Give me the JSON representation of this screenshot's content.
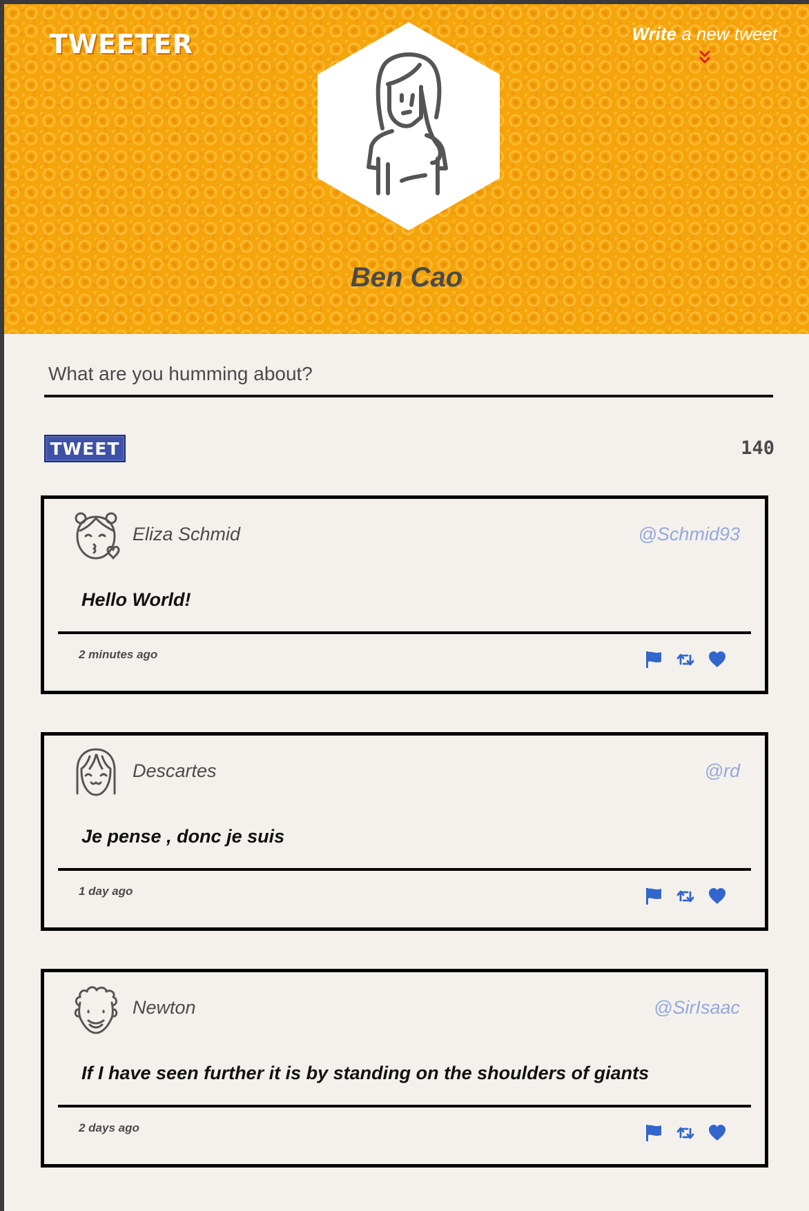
{
  "header": {
    "logo_text": "TWEETER",
    "compose_link_bold": "Write",
    "compose_link_rest": " a new tweet",
    "profile_name": "Ben Cao",
    "avatar_icon": "woman-avatar-icon",
    "compose_arrow_icon": "double-chevron-down-icon"
  },
  "composer": {
    "placeholder": "What are you humming about?",
    "value": "",
    "submit_label": "TWEET",
    "char_counter": "140"
  },
  "tweets": [
    {
      "name": "Eliza Schmid",
      "handle": "@Schmid93",
      "avatar_icon": "girl-kiss-avatar-icon",
      "body": "Hello World!",
      "time": "2 minutes ago"
    },
    {
      "name": "Descartes",
      "handle": "@rd",
      "avatar_icon": "girl-bangs-avatar-icon",
      "body": "Je pense , donc je suis",
      "time": "1 day ago"
    },
    {
      "name": "Newton",
      "handle": "@SirIsaac",
      "avatar_icon": "curly-hair-avatar-icon",
      "body": "If I have seen further it is by standing on the shoulders of giants",
      "time": "2 days ago"
    }
  ],
  "action_icons": [
    "flag-icon",
    "retweet-icon",
    "heart-icon"
  ],
  "colors": {
    "header_bg": "#f5a40c",
    "page_bg": "#f4f1ed",
    "accent_blue": "#3f51a4",
    "handle_blue": "#94a8db",
    "action_blue": "#3366cc",
    "arrow_red": "#e02020"
  }
}
